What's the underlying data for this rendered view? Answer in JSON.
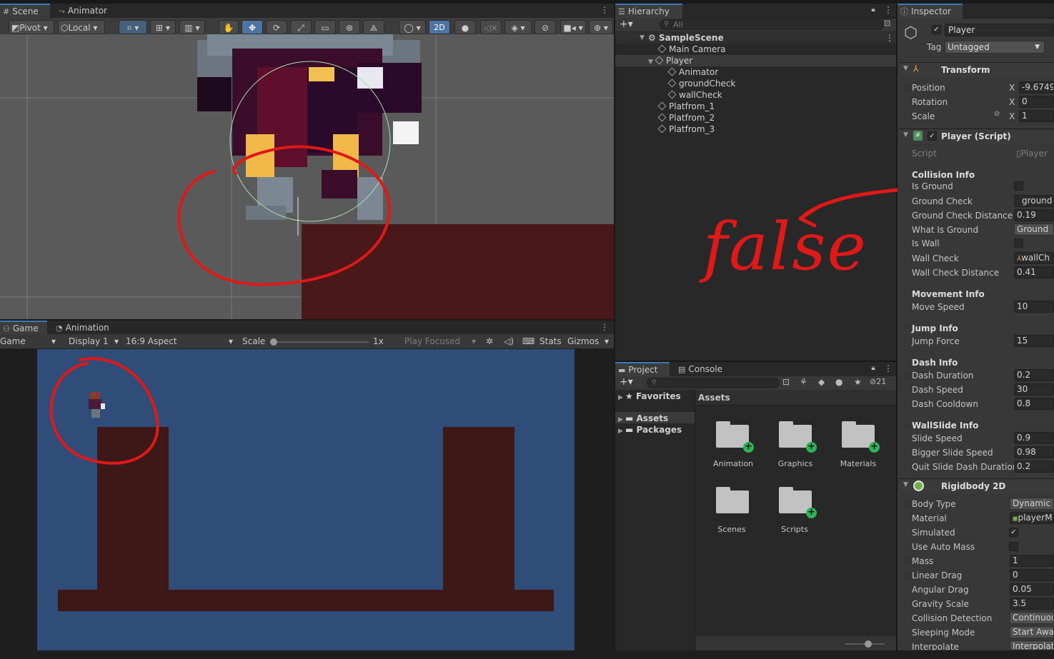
{
  "scene_panel": {
    "tabs": [
      "Scene",
      "Animator"
    ],
    "pivot_label": "Pivot",
    "local_label": "Local",
    "mode_2d_label": "2D"
  },
  "game_panel": {
    "tabs": [
      "Game",
      "Animation"
    ],
    "game_dropdown": "Game",
    "display_dropdown": "Display 1",
    "aspect_dropdown": "16:9 Aspect",
    "scale_label": "Scale",
    "scale_value": "1x",
    "play_focused": "Play Focused",
    "stats_label": "Stats",
    "gizmos_label": "Gizmos"
  },
  "hierarchy": {
    "title": "Hierarchy",
    "search_placeholder": "All",
    "scene_name": "SampleScene",
    "items": [
      "Main Camera",
      "Player",
      "Animator",
      "groundCheck",
      "wallCheck",
      "Platfrom_1",
      "Platfrom_2",
      "Platfrom_3"
    ]
  },
  "annotation": {
    "handwritten_text": "false",
    "color": "#e01818"
  },
  "project": {
    "tabs": [
      "Project",
      "Console"
    ],
    "hidden_count": "21",
    "tree": [
      "Favorites",
      "Assets",
      "Packages"
    ],
    "breadcrumb": "Assets",
    "folders": [
      "Animation",
      "Graphics",
      "Materials",
      "Scenes",
      "Scripts"
    ]
  },
  "inspector": {
    "title": "Inspector",
    "object_name": "Player",
    "tag_label": "Tag",
    "tag_value": "Untagged",
    "transform": {
      "title": "Transform",
      "position_label": "Position",
      "position_x": "-9.6749",
      "rotation_label": "Rotation",
      "rotation_x": "0",
      "scale_label": "Scale",
      "scale_x": "1",
      "axis_label": "X"
    },
    "player_script": {
      "title": "Player (Script)",
      "script_label": "Script",
      "script_value": "Player",
      "collision_header": "Collision Info",
      "is_ground_label": "Is Ground",
      "ground_check_label": "Ground Check",
      "ground_check_value": "ground",
      "ground_check_distance_label": "Ground Check Distance",
      "ground_check_distance": "0.19",
      "what_is_ground_label": "What Is Ground",
      "what_is_ground": "Ground",
      "is_wall_label": "Is Wall",
      "wall_check_label": "Wall Check",
      "wall_check_value": "wallCh",
      "wall_check_distance_label": "Wall Check Distance",
      "wall_check_distance": "0.41",
      "movement_header": "Movement Info",
      "move_speed_label": "Move Speed",
      "move_speed": "10",
      "jump_header": "Jump Info",
      "jump_force_label": "Jump Force",
      "jump_force": "15",
      "dash_header": "Dash Info",
      "dash_duration_label": "Dash Duration",
      "dash_duration": "0.2",
      "dash_speed_label": "Dash Speed",
      "dash_speed": "30",
      "dash_cooldown_label": "Dash Cooldown",
      "dash_cooldown": "0.8",
      "wallslide_header": "WallSlide Info",
      "slide_speed_label": "Slide Speed",
      "slide_speed": "0.9",
      "bigger_slide_speed_label": "Bigger Slide Speed",
      "bigger_slide_speed": "0.98",
      "quit_slide_label": "Quit Slide Dash Duration",
      "quit_slide": "0.2"
    },
    "rigidbody": {
      "title": "Rigidbody 2D",
      "body_type_label": "Body Type",
      "body_type": "Dynamic",
      "material_label": "Material",
      "material": "playerM",
      "simulated_label": "Simulated",
      "use_auto_mass_label": "Use Auto Mass",
      "mass_label": "Mass",
      "mass": "1",
      "linear_drag_label": "Linear Drag",
      "linear_drag": "0",
      "angular_drag_label": "Angular Drag",
      "angular_drag": "0.05",
      "gravity_scale_label": "Gravity Scale",
      "gravity_scale": "3.5",
      "collision_detection_label": "Collision Detection",
      "collision_detection": "Continuou",
      "sleeping_mode_label": "Sleeping Mode",
      "sleeping_mode": "Start Awak",
      "interpolate_label": "Interpolate",
      "interpolate": "Interpolate"
    }
  }
}
